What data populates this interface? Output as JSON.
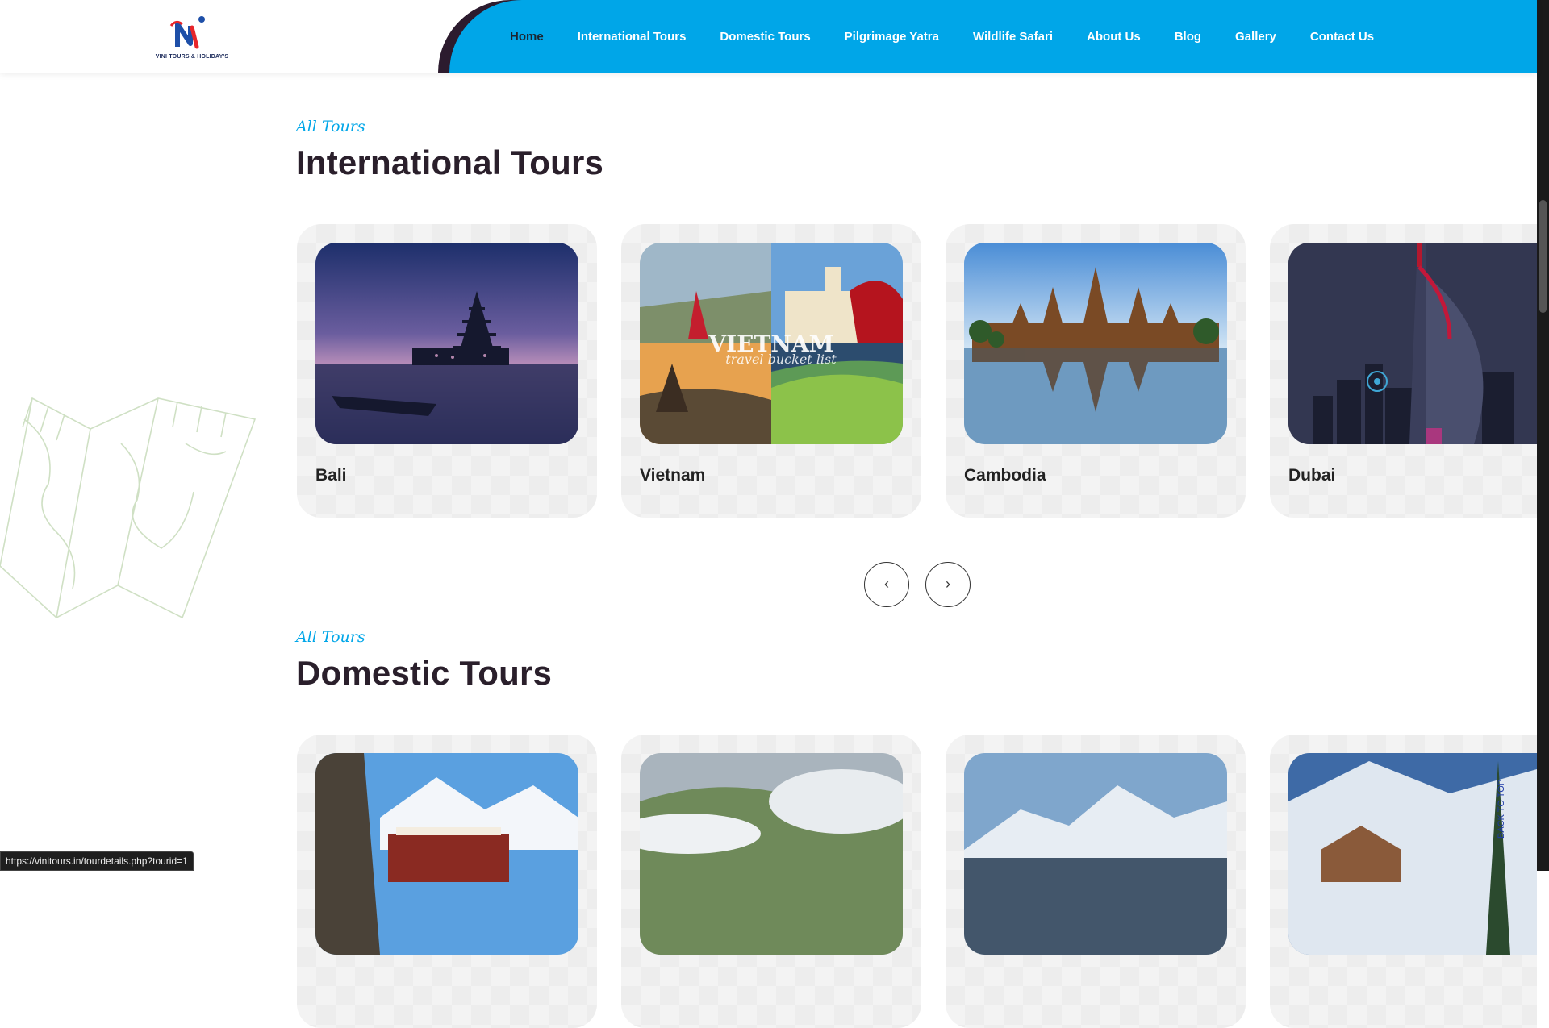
{
  "header": {
    "logo_text": "VINI TOURS & HOLIDAY'S",
    "nav": [
      {
        "label": "Home",
        "active": true
      },
      {
        "label": "International Tours"
      },
      {
        "label": "Domestic Tours"
      },
      {
        "label": "Pilgrimage Yatra"
      },
      {
        "label": "Wildlife Safari"
      },
      {
        "label": "About Us"
      },
      {
        "label": "Blog"
      },
      {
        "label": "Gallery"
      },
      {
        "label": "Contact Us"
      }
    ]
  },
  "international": {
    "tag": "All Tours",
    "title": "International Tours",
    "cards": [
      {
        "name": "Bali"
      },
      {
        "name": "Vietnam",
        "photo_text": "VIETNAM",
        "photo_subtext": "travel bucket list"
      },
      {
        "name": "Cambodia"
      },
      {
        "name": "Dubai"
      }
    ],
    "prev_glyph": "‹",
    "next_glyph": "›"
  },
  "domestic": {
    "tag": "All Tours",
    "title": "Domestic Tours"
  },
  "status_bar": "https://vinitours.in/tourdetails.php?tourid=1",
  "back_to_top": "BACK TO TOP",
  "colors": {
    "accent": "#00a6e8",
    "dark": "#2c1b2e"
  }
}
